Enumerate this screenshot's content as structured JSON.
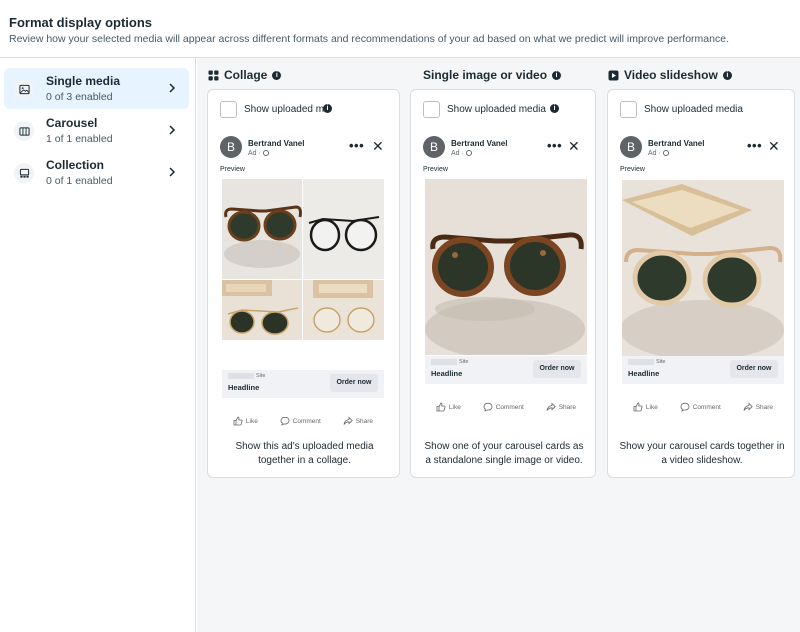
{
  "header": {
    "title": "Format display options",
    "subtitle": "Review how your selected media will appear across different formats and recommendations of your ad based on what we predict will improve performance."
  },
  "sidebar": {
    "items": [
      {
        "label": "Single media",
        "status": "0 of 3 enabled",
        "icon": "image-icon",
        "active": true
      },
      {
        "label": "Carousel",
        "status": "1 of 1 enabled",
        "icon": "carousel-icon",
        "active": false
      },
      {
        "label": "Collection",
        "status": "0 of 1 enabled",
        "icon": "collection-icon",
        "active": false
      }
    ]
  },
  "columns": [
    {
      "title": "Collage",
      "icon": "grid-icon",
      "checkbox_label": "Show uploaded me",
      "advertiser": "Bertrand Vanel",
      "avatar_letter": "B",
      "ad_label": "Ad ·",
      "preview_label": "Preview",
      "site_label": "Site",
      "headline": "Headline",
      "cta": "Order now",
      "actions": [
        "Like",
        "Comment",
        "Share"
      ],
      "description": "Show this ad's uploaded media together in a collage."
    },
    {
      "title": "Single image or video",
      "icon": "",
      "checkbox_label": "Show uploaded media",
      "advertiser": "Bertrand Vanel",
      "avatar_letter": "B",
      "ad_label": "Ad ·",
      "preview_label": "Preview",
      "site_label": "Site",
      "headline": "Headline",
      "cta": "Order now",
      "actions": [
        "Like",
        "Comment",
        "Share"
      ],
      "description": "Show one of your carousel cards as a standalone single image or video."
    },
    {
      "title": "Video slideshow",
      "icon": "play-icon",
      "checkbox_label": "Show uploaded media",
      "advertiser": "Bertrand Vanel",
      "avatar_letter": "B",
      "ad_label": "Ad ·",
      "preview_label": "Preview",
      "site_label": "Site",
      "headline": "Headline",
      "cta": "Order now",
      "actions": [
        "Like",
        "Comment",
        "Share"
      ],
      "description": "Show your carousel cards together in a video slideshow."
    }
  ],
  "colors": {
    "active_bg": "#e7f3ff",
    "text": "#1c2b33",
    "muted": "#465a69",
    "panel_bg": "#f5f6f7"
  }
}
